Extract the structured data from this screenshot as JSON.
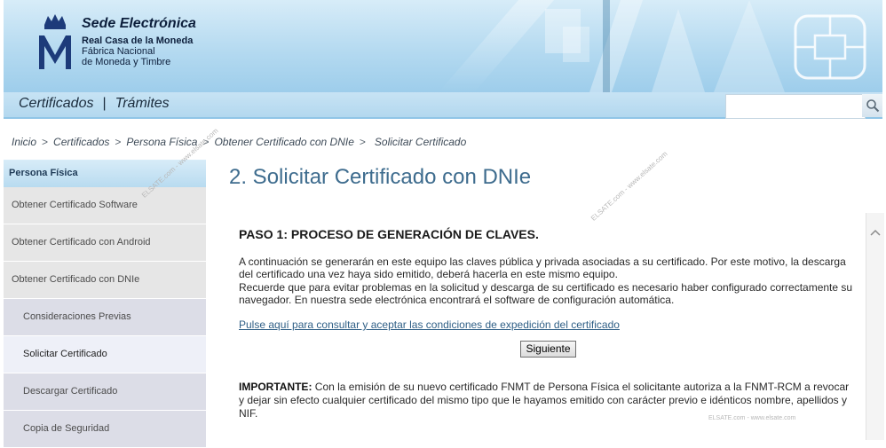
{
  "header": {
    "title": "Sede Electrónica",
    "subtitle1": "Real Casa de la Moneda",
    "subtitle2": "Fábrica Nacional",
    "subtitle3": "de Moneda y Timbre"
  },
  "nav": {
    "item1": "Certificados",
    "separator": "|",
    "item2": "Trámites"
  },
  "search": {
    "value": "",
    "placeholder": ""
  },
  "breadcrumb": {
    "items": [
      "Inicio",
      "Certificados",
      "Persona Física",
      "Obtener Certificado con DNIe"
    ],
    "separator": ">",
    "current": "Solicitar Certificado"
  },
  "sidebar": {
    "header": "Persona Física",
    "items": [
      "Obtener Certificado Software",
      "Obtener Certificado con Android",
      "Obtener Certificado con DNIe",
      "Consideraciones Previas",
      "Solicitar Certificado",
      "Descargar Certificado",
      "Copia de Seguridad"
    ]
  },
  "main": {
    "title": "2. Solicitar Certificado con DNIe",
    "step_title": "PASO 1: PROCESO DE GENERACIÓN DE CLAVES.",
    "paragraph1": "A continuación se generarán en este equipo las claves pública y privada asociadas a su certificado. Por este motivo, la descarga del certificado una vez haya sido emitido, deberá hacerla en este mismo equipo.",
    "paragraph2": "Recuerde que para evitar problemas en la solicitud y descarga de su certificado es necesario haber configurado correctamente su navegador. En nuestra sede electrónica encontrará el software de configuración automática.",
    "link": "Pulse aquí para consultar y aceptar las condiciones de expedición del certificado",
    "button": "Siguiente",
    "important_label": "IMPORTANTE:",
    "important_text": "Con la emisión de su nuevo certificado FNMT de Persona Física el solicitante autoriza a la FNMT-RCM a revocar y dejar sin efecto cualquier certificado del mismo tipo que le hayamos emitido con carácter previo e idénticos nombre, apellidos y NIF."
  },
  "watermarks": {
    "wm1": "ELSATE.com - www.elsate.com",
    "wm2": "ELSATE.com - www.elsate.com",
    "wm3": "ELSATE.com - www.elsate.com"
  },
  "colors": {
    "accent": "#3e6c8e",
    "header_bg": "#b3d9f0",
    "link": "#2f5f86"
  },
  "icons": {
    "search": "search-icon",
    "scroll_up": "chevron-up-icon",
    "logo": "crown-m-logo-icon",
    "chip": "smartcard-chip-icon"
  }
}
